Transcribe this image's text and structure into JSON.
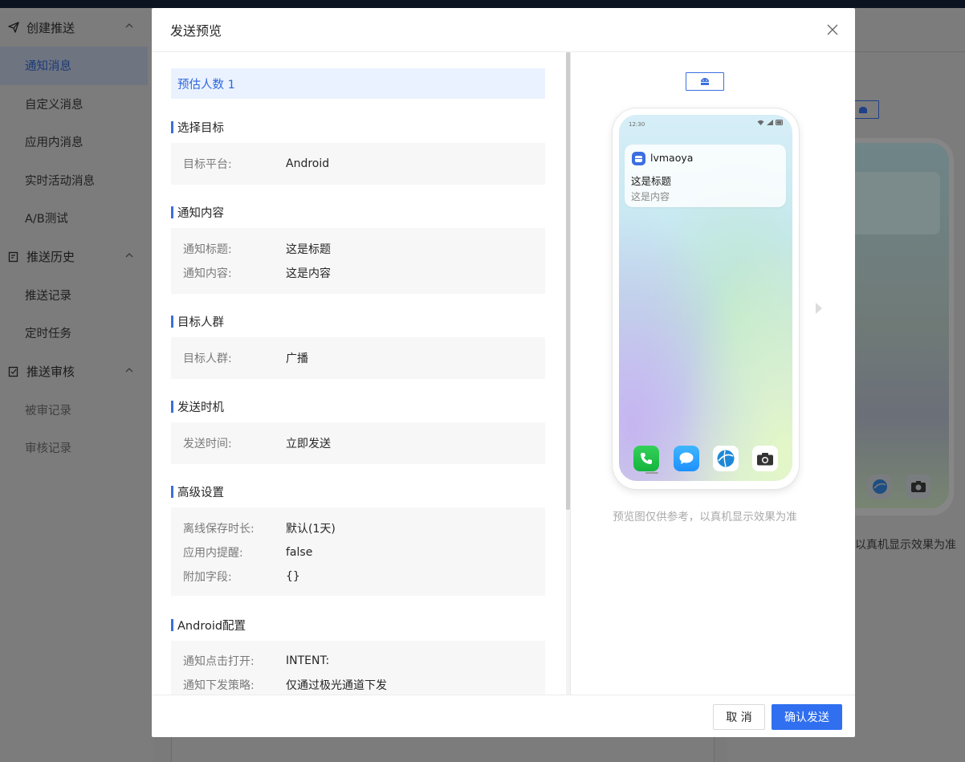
{
  "sidebar": {
    "groups": [
      {
        "label": "创建推送",
        "icon": "send-icon"
      },
      {
        "label": "推送历史",
        "icon": "history-icon"
      },
      {
        "label": "推送审核",
        "icon": "review-icon"
      }
    ],
    "items": [
      {
        "label": "通知消息"
      },
      {
        "label": "自定义消息"
      },
      {
        "label": "应用内消息"
      },
      {
        "label": "实时活动消息"
      },
      {
        "label": "A/B测试"
      },
      {
        "label": "推送记录"
      },
      {
        "label": "定时任务"
      },
      {
        "label": "被审记录"
      },
      {
        "label": "审核记录"
      }
    ]
  },
  "background": {
    "preview_note_tail": "以真机显示效果为准"
  },
  "modal": {
    "title": "发送预览",
    "estimate": "预估人数 1",
    "sections": {
      "target": {
        "title": "选择目标",
        "rows": [
          {
            "label": "目标平台:",
            "value": "Android"
          }
        ]
      },
      "content": {
        "title": "通知内容",
        "rows": [
          {
            "label": "通知标题:",
            "value": "这是标题"
          },
          {
            "label": "通知内容:",
            "value": "这是内容"
          }
        ]
      },
      "audience": {
        "title": "目标人群",
        "rows": [
          {
            "label": "目标人群:",
            "value": "广播"
          }
        ]
      },
      "timing": {
        "title": "发送时机",
        "rows": [
          {
            "label": "发送时间:",
            "value": "立即发送"
          }
        ]
      },
      "advanced": {
        "title": "高级设置",
        "rows": [
          {
            "label": "离线保存时长:",
            "value": "默认(1天)"
          },
          {
            "label": "应用内提醒:",
            "value": "false"
          },
          {
            "label": "附加字段:",
            "value": "{}"
          }
        ]
      },
      "android": {
        "title": "Android配置",
        "rows": [
          {
            "label": "通知点击打开:",
            "value": "INTENT:"
          },
          {
            "label": "通知下发策略:",
            "value": "仅通过极光通道下发"
          }
        ]
      }
    },
    "preview": {
      "platform_icon": "android-icon",
      "status_time": "12:30",
      "notification": {
        "app_name": "lvmaoya",
        "title": "这是标题",
        "body": "这是内容"
      },
      "dock_icons": [
        "phone-icon",
        "message-icon",
        "browser-icon",
        "camera-icon"
      ],
      "note": "预览图仅供参考，以真机显示效果为准"
    },
    "footer": {
      "cancel_label": "取 消",
      "confirm_label": "确认发送"
    }
  },
  "colors": {
    "accent": "#2f6ff0",
    "section_bar": "#3b6fe0",
    "estimate_bg": "#ebf2ff"
  }
}
